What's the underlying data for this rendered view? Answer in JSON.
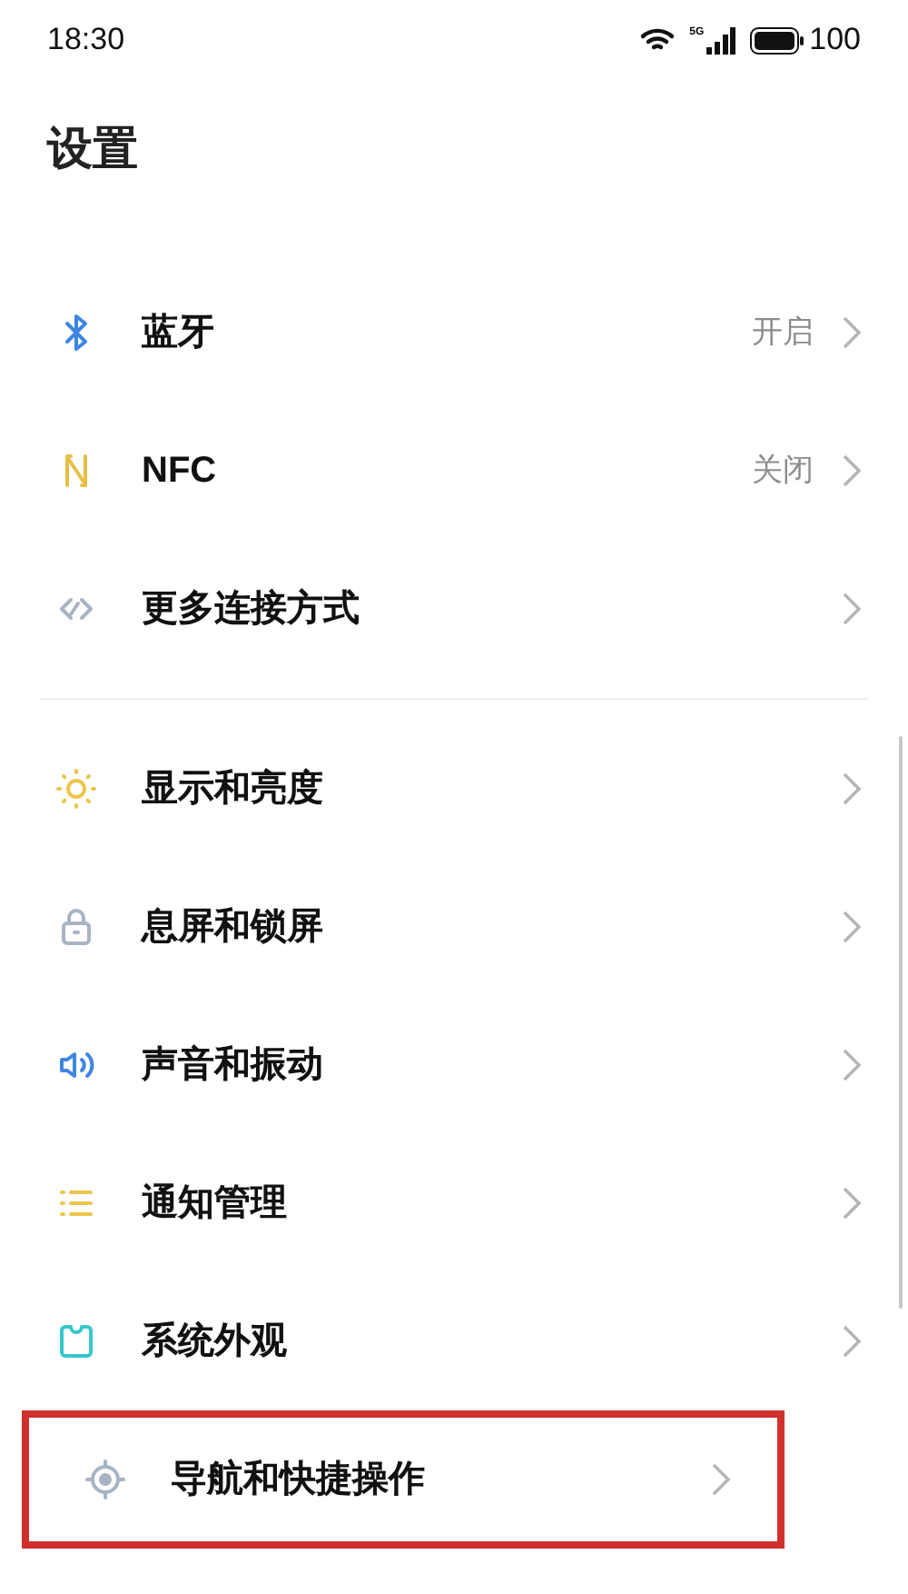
{
  "status_bar": {
    "time": "18:30",
    "network": "5G",
    "battery": "100"
  },
  "title": "设置",
  "sections": [
    {
      "items": [
        {
          "kind": "bluetooth",
          "label": "蓝牙",
          "value": "开启",
          "highlighted": false
        },
        {
          "kind": "nfc",
          "label": "NFC",
          "value": "关闭",
          "highlighted": false
        },
        {
          "kind": "link",
          "label": "更多连接方式",
          "highlighted": false
        }
      ]
    },
    {
      "items": [
        {
          "kind": "sun",
          "label": "显示和亮度",
          "highlighted": false
        },
        {
          "kind": "lock",
          "label": "息屏和锁屏",
          "highlighted": false
        },
        {
          "kind": "sound",
          "label": "声音和振动",
          "highlighted": false
        },
        {
          "kind": "list",
          "label": "通知管理",
          "highlighted": false
        },
        {
          "kind": "theme",
          "label": "系统外观",
          "highlighted": false
        },
        {
          "kind": "target",
          "label": "导航和快捷操作",
          "highlighted": true
        }
      ]
    }
  ]
}
